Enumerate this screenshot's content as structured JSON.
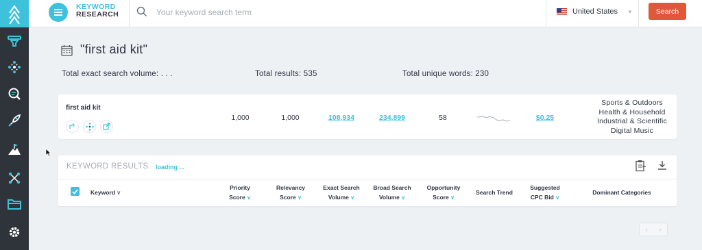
{
  "brand": {
    "line1": "KEYWORD",
    "line2": "RESEARCH"
  },
  "search": {
    "placeholder": "Your keyword search term",
    "value": "",
    "country": "United States",
    "button_label": "Search"
  },
  "page": {
    "title": "\"first aid kit\"",
    "stats": {
      "exact_volume": "Total exact search volume: . . .",
      "total_results": "Total results: 535",
      "unique_words": "Total unique words: 230"
    }
  },
  "keyword_card": {
    "keyword": "first aid kit",
    "priority_score": "1,000",
    "relevancy_score": "1,000",
    "exact_search_volume": "108,934",
    "broad_search_volume": "234,899",
    "opportunity_score": "58",
    "cpc_bid": "$0.25",
    "categories": [
      "Sports & Outdoors",
      "Health & Household",
      "Industrial & Scientific",
      "Digital Music"
    ]
  },
  "results": {
    "title": "KEYWORD RESULTS",
    "status": "loading ...",
    "columns": {
      "keyword": "Keyword",
      "priority_1": "Priority",
      "priority_2": "Score",
      "relevancy_1": "Relevancy",
      "relevancy_2": "Score",
      "exact_1": "Exact Search",
      "exact_2": "Volume",
      "broad_1": "Broad Search",
      "broad_2": "Volume",
      "opportunity_1": "Opportunity",
      "opportunity_2": "Score",
      "trend": "Search Trend",
      "cpc_1": "Suggested",
      "cpc_2": "CPC Bid",
      "categories": "Dominant Categories"
    }
  },
  "colors": {
    "accent": "#3ec2dc",
    "sidebar": "#2f343a",
    "button": "#e0573a",
    "background": "#eef1f4"
  },
  "icons": [
    "logo-icon",
    "funnel-icon",
    "network-icon",
    "keyword-search-icon",
    "rocket-icon",
    "mountain-flag-icon",
    "share-nodes-icon",
    "folder-icon",
    "gear-icon",
    "menu-icon",
    "search-icon",
    "calendar-icon",
    "clipboard-icon",
    "download-icon"
  ]
}
